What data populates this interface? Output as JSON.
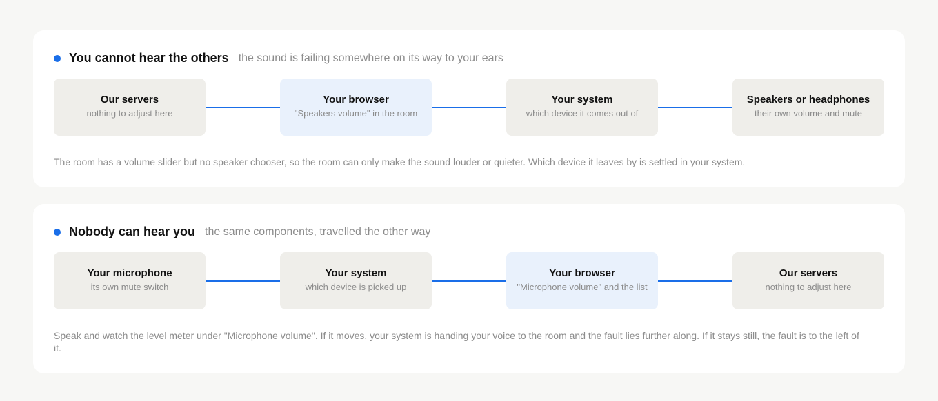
{
  "colors": {
    "accent": "#1a6ee8",
    "box_default": "#efeeea",
    "box_highlight": "#e9f1fc",
    "muted_text": "#8c8c8c"
  },
  "sections": [
    {
      "title": "You cannot hear the others",
      "subtitle": "the sound is failing somewhere on its way to your ears",
      "steps": [
        {
          "label": "Our servers",
          "desc": "nothing to adjust here",
          "highlighted": false
        },
        {
          "label": "Your browser",
          "desc": "\"Speakers volume\" in the room",
          "highlighted": true
        },
        {
          "label": "Your system",
          "desc": "which device it comes out of",
          "highlighted": false
        },
        {
          "label": "Speakers or headphones",
          "desc": "their own volume and mute",
          "highlighted": false
        }
      ],
      "note": "The room has a volume slider but no speaker chooser, so the room can only make the sound louder or quieter. Which device it leaves by is settled in your system."
    },
    {
      "title": "Nobody can hear you",
      "subtitle": "the same components, travelled the other way",
      "steps": [
        {
          "label": "Your microphone",
          "desc": "its own mute switch",
          "highlighted": false
        },
        {
          "label": "Your system",
          "desc": "which device is picked up",
          "highlighted": false
        },
        {
          "label": "Your browser",
          "desc": "\"Microphone volume\" and the list",
          "highlighted": true
        },
        {
          "label": "Our servers",
          "desc": "nothing to adjust here",
          "highlighted": false
        }
      ],
      "note": "Speak and watch the level meter under \"Microphone volume\". If it moves, your system is handing your voice to the room and the fault lies further along. If it stays still, the fault is to the left of it."
    }
  ]
}
